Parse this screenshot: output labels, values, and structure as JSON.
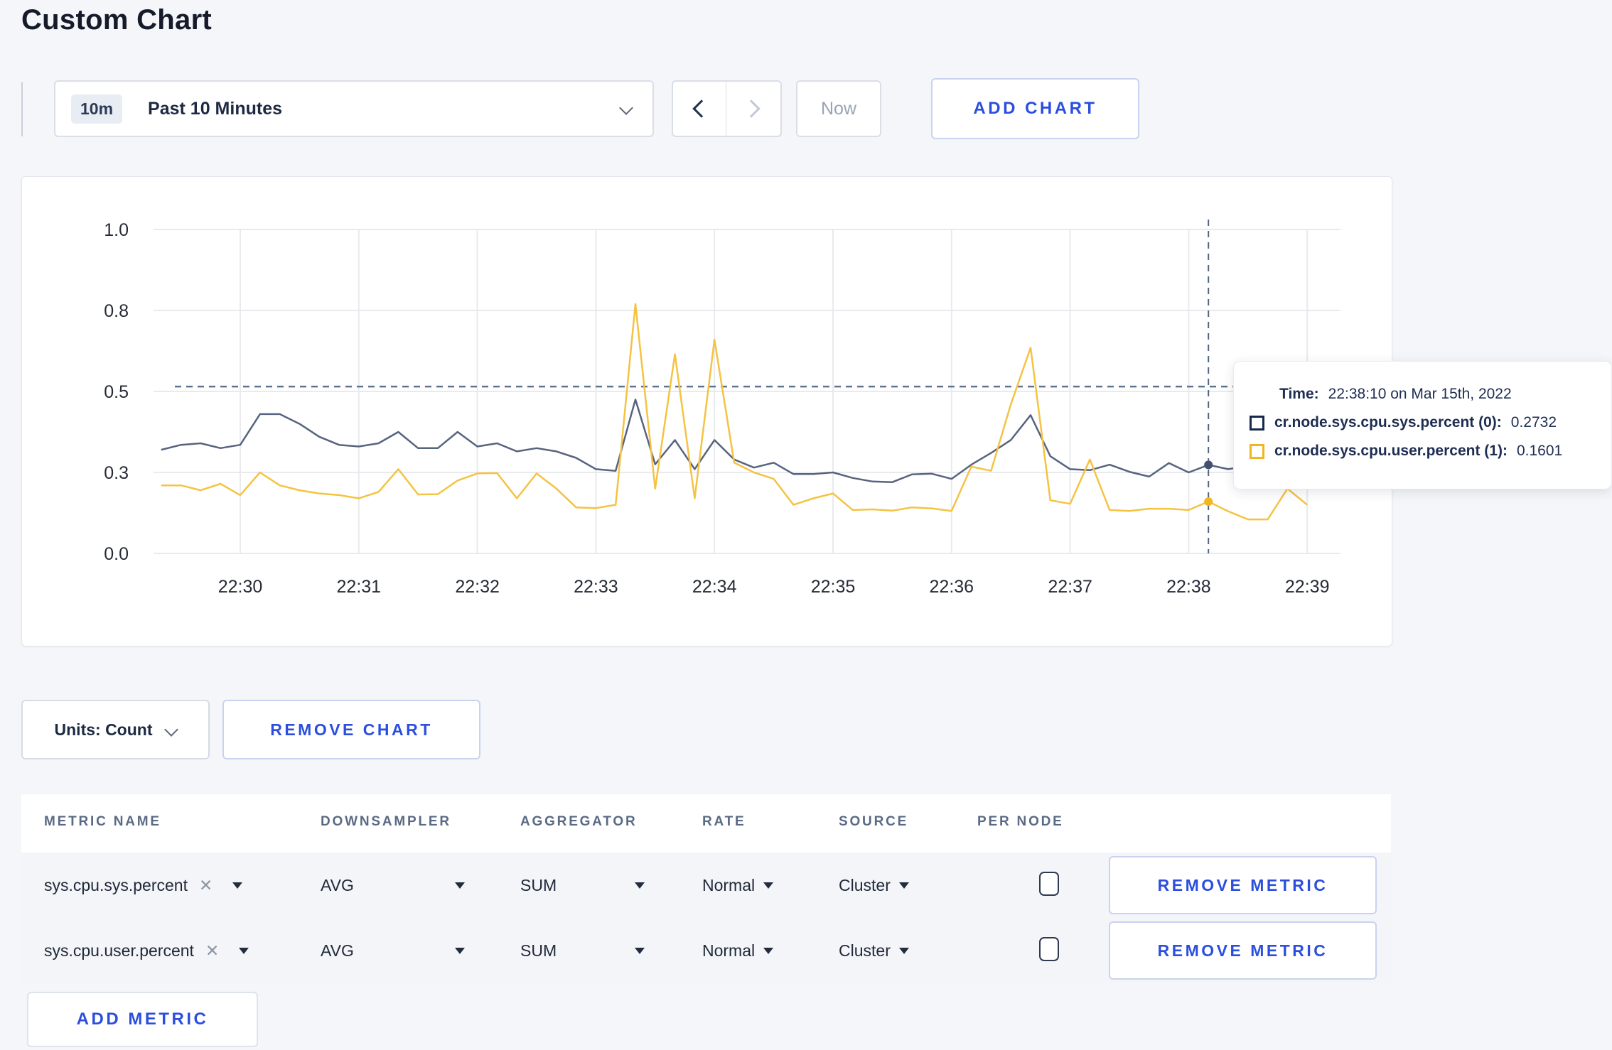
{
  "page": {
    "title": "Custom Chart"
  },
  "toolbar": {
    "time_badge": "10m",
    "time_label": "Past 10 Minutes",
    "now_label": "Now",
    "add_chart_label": "ADD CHART"
  },
  "icons": {
    "close_glyph": "✕"
  },
  "tooltip": {
    "time_label": "Time:",
    "time_value": "22:38:10 on Mar 15th, 2022",
    "series": [
      {
        "label": "cr.node.sys.cpu.sys.percent (0):",
        "value": "0.2732",
        "color": "#16264d"
      },
      {
        "label": "cr.node.sys.cpu.user.percent (1):",
        "value": "0.1601",
        "color": "#f0b51f"
      }
    ]
  },
  "chart_data": {
    "type": "line",
    "title": "",
    "xlabel": "",
    "ylabel": "",
    "ylim": [
      0,
      1
    ],
    "grid": true,
    "x_ticks": [
      "22:30",
      "22:31",
      "22:32",
      "22:33",
      "22:34",
      "22:35",
      "22:36",
      "22:37",
      "22:38",
      "22:39"
    ],
    "y_ticks": [
      {
        "v": 0.0,
        "label": "0.0"
      },
      {
        "v": 0.25,
        "label": "0.3"
      },
      {
        "v": 0.5,
        "label": "0.5"
      },
      {
        "v": 0.75,
        "label": "0.8"
      },
      {
        "v": 1.0,
        "label": "1.0"
      }
    ],
    "x": [
      "22:29:20",
      "22:29:30",
      "22:29:40",
      "22:29:50",
      "22:30:00",
      "22:30:10",
      "22:30:20",
      "22:30:30",
      "22:30:40",
      "22:30:50",
      "22:31:00",
      "22:31:10",
      "22:31:20",
      "22:31:30",
      "22:31:40",
      "22:31:50",
      "22:32:00",
      "22:32:10",
      "22:32:20",
      "22:32:30",
      "22:32:40",
      "22:32:50",
      "22:33:00",
      "22:33:10",
      "22:33:20",
      "22:33:30",
      "22:33:40",
      "22:33:50",
      "22:34:00",
      "22:34:10",
      "22:34:20",
      "22:34:30",
      "22:34:40",
      "22:34:50",
      "22:35:00",
      "22:35:10",
      "22:35:20",
      "22:35:30",
      "22:35:40",
      "22:35:50",
      "22:36:00",
      "22:36:10",
      "22:36:20",
      "22:36:30",
      "22:36:40",
      "22:36:50",
      "22:37:00",
      "22:37:10",
      "22:37:20",
      "22:37:30",
      "22:37:40",
      "22:37:50",
      "22:38:00",
      "22:38:10",
      "22:38:20",
      "22:38:30",
      "22:38:40",
      "22:38:50",
      "22:39:00"
    ],
    "series": [
      {
        "name": "cr.node.sys.cpu.sys.percent",
        "color": "#57647f",
        "values": [
          0.32,
          0.335,
          0.34,
          0.325,
          0.335,
          0.43,
          0.43,
          0.4,
          0.36,
          0.335,
          0.33,
          0.34,
          0.375,
          0.325,
          0.325,
          0.375,
          0.33,
          0.34,
          0.315,
          0.325,
          0.315,
          0.295,
          0.26,
          0.255,
          0.475,
          0.275,
          0.35,
          0.26,
          0.35,
          0.29,
          0.265,
          0.28,
          0.245,
          0.245,
          0.25,
          0.233,
          0.222,
          0.22,
          0.244,
          0.246,
          0.23,
          0.274,
          0.31,
          0.35,
          0.427,
          0.3,
          0.26,
          0.257,
          0.274,
          0.252,
          0.237,
          0.279,
          0.25,
          0.2732,
          0.26,
          0.27,
          0.28,
          0.27,
          0.26
        ]
      },
      {
        "name": "cr.node.sys.cpu.user.percent",
        "color": "#f5c342",
        "values": [
          0.21,
          0.21,
          0.195,
          0.215,
          0.18,
          0.25,
          0.21,
          0.195,
          0.185,
          0.18,
          0.17,
          0.19,
          0.26,
          0.182,
          0.183,
          0.225,
          0.247,
          0.248,
          0.17,
          0.247,
          0.2,
          0.142,
          0.14,
          0.15,
          0.77,
          0.2,
          0.615,
          0.17,
          0.66,
          0.28,
          0.25,
          0.23,
          0.15,
          0.17,
          0.185,
          0.134,
          0.136,
          0.132,
          0.142,
          0.139,
          0.131,
          0.268,
          0.255,
          0.46,
          0.635,
          0.164,
          0.153,
          0.29,
          0.134,
          0.131,
          0.138,
          0.138,
          0.134,
          0.1601,
          0.13,
          0.105,
          0.105,
          0.2,
          0.15
        ]
      }
    ],
    "crosshair": {
      "time": "22:38:10",
      "x_index": 53,
      "hline_value": 0.515,
      "points": [
        {
          "series": 0,
          "value": 0.2732
        },
        {
          "series": 1,
          "value": 0.1601
        }
      ]
    },
    "legend_position": "tooltip-overlay"
  },
  "chart_card": {
    "units_label": "Units: Count",
    "remove_chart_label": "REMOVE CHART"
  },
  "table": {
    "headers": [
      "METRIC NAME",
      "DOWNSAMPLER",
      "AGGREGATOR",
      "RATE",
      "SOURCE",
      "PER NODE"
    ],
    "rows": [
      {
        "metric": "sys.cpu.sys.percent",
        "downsampler": "AVG",
        "aggregator": "SUM",
        "rate": "Normal",
        "source": "Cluster",
        "per_node_checked": false,
        "remove_label": "REMOVE METRIC"
      },
      {
        "metric": "sys.cpu.user.percent",
        "downsampler": "AVG",
        "aggregator": "SUM",
        "rate": "Normal",
        "source": "Cluster",
        "per_node_checked": false,
        "remove_label": "REMOVE METRIC"
      }
    ],
    "add_metric_label": "ADD METRIC"
  }
}
